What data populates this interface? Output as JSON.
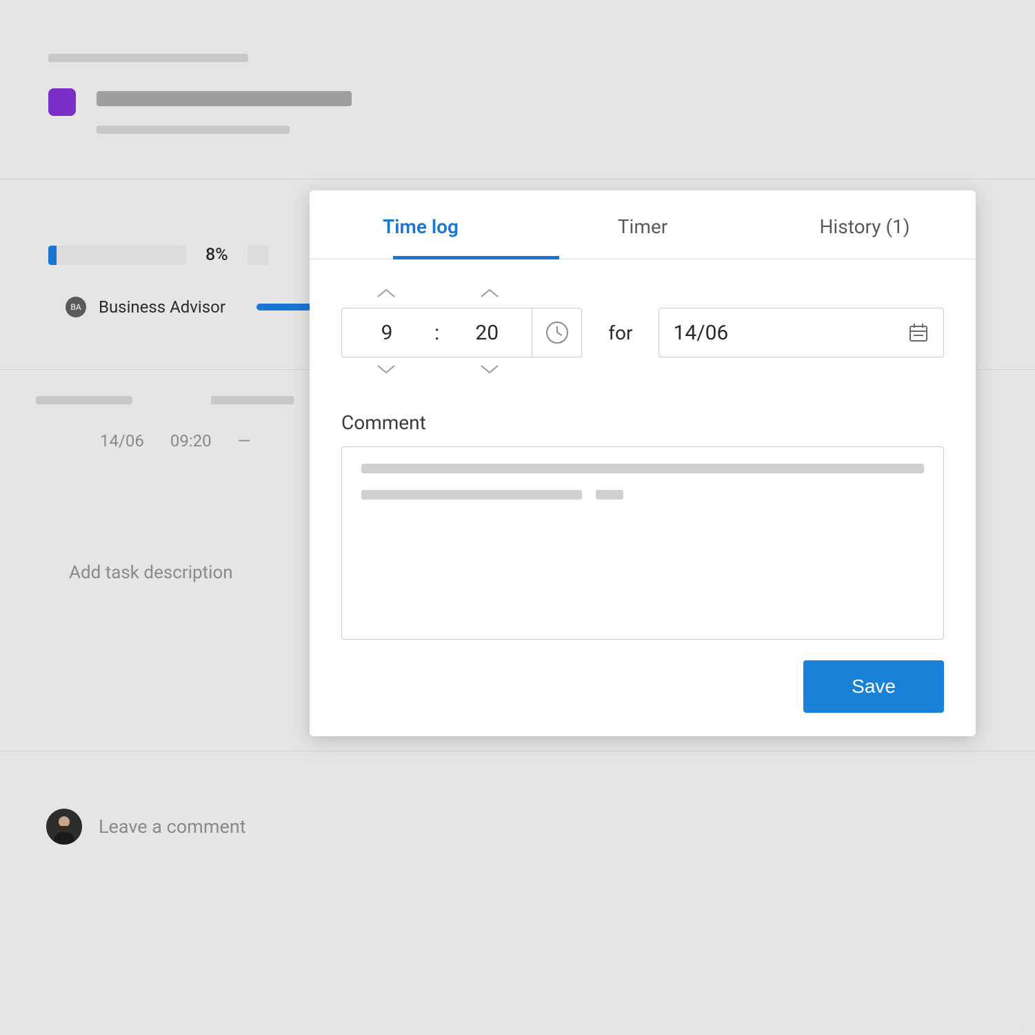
{
  "header": {
    "progress_pct": "8%"
  },
  "assignee": {
    "initials": "BA",
    "name": "Business Advisor"
  },
  "meta": {
    "date": "14/06",
    "time": "09:20",
    "dash": "—"
  },
  "description": {
    "placeholder": "Add task description"
  },
  "footer": {
    "comment_placeholder": "Leave a comment"
  },
  "modal": {
    "tabs": {
      "timelog": "Time log",
      "timer": "Timer",
      "history": "History (1)"
    },
    "time": {
      "hours": "9",
      "minutes": "20",
      "for_label": "for",
      "date": "14/06"
    },
    "comment_label": "Comment",
    "save_label": "Save"
  }
}
